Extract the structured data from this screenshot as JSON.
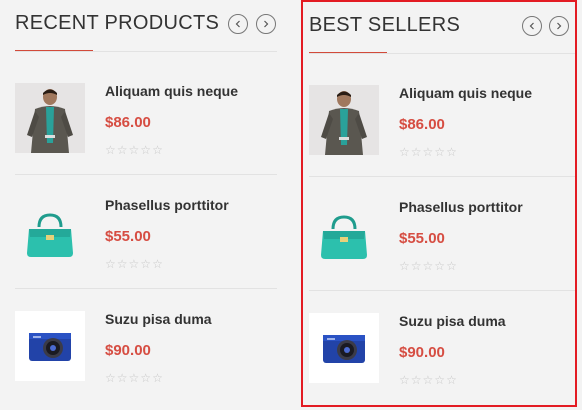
{
  "recent": {
    "title": "RECENT PRODUCTS",
    "products": [
      {
        "name": "Aliquam quis neque",
        "price": "$86.00",
        "rating": 0,
        "icon": "man-jacket-image"
      },
      {
        "name": "Phasellus porttitor",
        "price": "$55.00",
        "rating": 0,
        "icon": "teal-handbag-image"
      },
      {
        "name": "Suzu pisa duma",
        "price": "$90.00",
        "rating": 0,
        "icon": "blue-camera-image"
      }
    ]
  },
  "bestsellers": {
    "title": "BEST SELLERS",
    "products": [
      {
        "name": "Aliquam quis neque",
        "price": "$86.00",
        "rating": 0,
        "icon": "man-jacket-image"
      },
      {
        "name": "Phasellus porttitor",
        "price": "$55.00",
        "rating": 0,
        "icon": "teal-handbag-image"
      },
      {
        "name": "Suzu pisa duma",
        "price": "$90.00",
        "rating": 0,
        "icon": "blue-camera-image"
      }
    ]
  },
  "colors": {
    "accent": "#d64d42",
    "highlight_border": "#e31b23",
    "background": "#f3f3f3"
  }
}
